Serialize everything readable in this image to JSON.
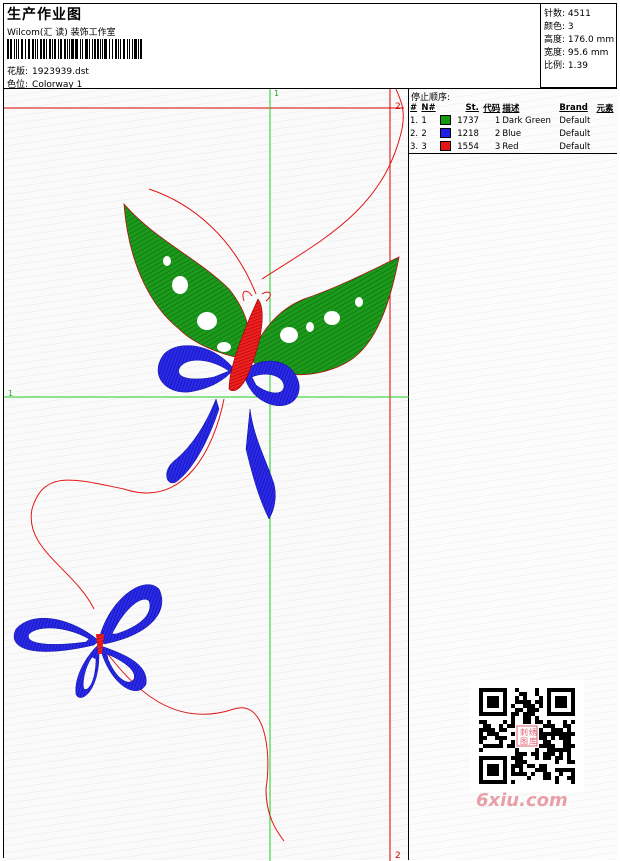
{
  "header": {
    "title": "生产作业图",
    "studio": "Wilcom(汇 读) 装饰工作室",
    "design_label": "花版:",
    "design_value": "1923939.dst",
    "colorway_label": "色位:",
    "colorway_value": "Colorway 1"
  },
  "stats": {
    "stitches_label": "针数:",
    "stitches_value": "4511",
    "colors_label": "颜色:",
    "colors_value": "3",
    "height_label": "高度:",
    "height_value": "176.0 mm",
    "width_label": "宽度:",
    "width_value": "95.6 mm",
    "ratio_label": "比例:",
    "ratio_value": "1.39"
  },
  "guides": {
    "h_top": "2",
    "v_left": "1",
    "h_mid": "1",
    "h_bottom": "2"
  },
  "stop_sequence": {
    "heading": "停止顺序:",
    "columns": [
      "#",
      "N#",
      "St.",
      "代码",
      "描述",
      "Brand",
      "元素"
    ],
    "rows": [
      {
        "idx": "1.",
        "n": "1",
        "color": "#0f9a0f",
        "stitches": "1737",
        "code": "1",
        "desc": "Dark Green",
        "brand": "Default"
      },
      {
        "idx": "2.",
        "n": "2",
        "color": "#1e1ee6",
        "stitches": "1218",
        "code": "2",
        "desc": "Blue",
        "brand": "Default"
      },
      {
        "idx": "3.",
        "n": "3",
        "color": "#e61414",
        "stitches": "1554",
        "code": "3",
        "desc": "Red",
        "brand": "Default"
      }
    ]
  },
  "watermark": {
    "qr_stamp": "刺绣图库",
    "site": "6xiu.com"
  }
}
